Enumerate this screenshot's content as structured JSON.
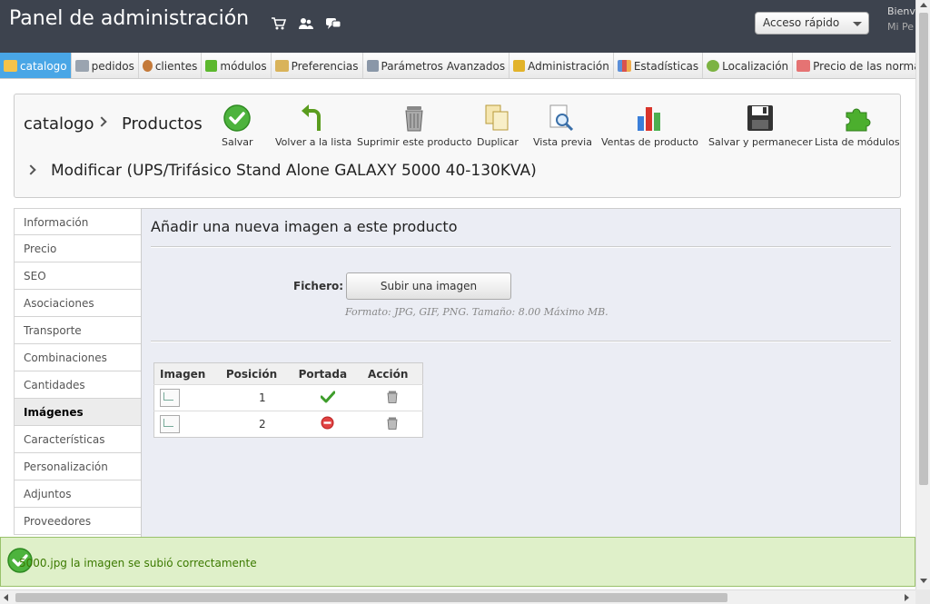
{
  "header": {
    "title": "Panel de administración",
    "icons": [
      "cart-icon",
      "users-icon",
      "chat-icon"
    ],
    "quick_access": "Acceso rápido",
    "welcome": "Bienv",
    "welcome_sub": "Mi Pe"
  },
  "menu": {
    "items": [
      {
        "label": "catalogo",
        "icon": "folder-icon",
        "color": "#f6c34a"
      },
      {
        "label": "pedidos",
        "icon": "cart-icon",
        "color": "#9aa4b0"
      },
      {
        "label": "clientes",
        "icon": "user-icon",
        "color": "#c47a3a"
      },
      {
        "label": "módulos",
        "icon": "puzzle-icon",
        "color": "#5cb82e"
      },
      {
        "label": "Preferencias",
        "icon": "pencil-icon",
        "color": "#d9b35a"
      },
      {
        "label": "Parámetros Avanzados",
        "icon": "wrench-icon",
        "color": "#8a97a8"
      },
      {
        "label": "Administración",
        "icon": "key-icon",
        "color": "#e2b32a"
      },
      {
        "label": "Estadísticas",
        "icon": "bar-chart-icon",
        "color": "#d9534f"
      },
      {
        "label": "Localización",
        "icon": "globe-icon",
        "color": "#7cb342"
      },
      {
        "label": "Precio de las norma",
        "icon": "price-icon",
        "color": "#e57373"
      }
    ]
  },
  "toolbar": {
    "crumb1": "catalogo",
    "crumb2": "Productos",
    "edit_title": "Modificar (UPS/Trifásico Stand Alone GALAXY 5000 40-130KVA)",
    "buttons": {
      "save": "Salvar",
      "back": "Volver a la lista",
      "delete": "Suprimir este producto",
      "duplicate": "Duplicar",
      "preview": "Vista previa",
      "sales": "Ventas de producto",
      "save_stay": "Salvar y permanecer",
      "modules": "Lista de módulos"
    }
  },
  "tabs": [
    "Información",
    "Precio",
    "SEO",
    "Asociaciones",
    "Transporte",
    "Combinaciones",
    "Cantidades",
    "Imágenes",
    "Características",
    "Personalización",
    "Adjuntos",
    "Proveedores"
  ],
  "active_tab": "Imágenes",
  "content": {
    "title": "Añadir una nueva imagen a este producto",
    "file_label": "Fichero:",
    "upload_button": "Subir una imagen",
    "format_hint": "Formato: JPG, GIF, PNG. Tamaño: 8.00 Máximo MB.",
    "table": {
      "headers": [
        "Imagen",
        "Posición",
        "Portada",
        "Acción"
      ],
      "rows": [
        {
          "position": "1",
          "cover": true
        },
        {
          "position": "2",
          "cover": false
        }
      ]
    }
  },
  "notification": {
    "message": "5000.jpg la imagen se subió correctamente"
  },
  "colors": {
    "header_bg": "#3d434e",
    "active_menu": "#49a6e6",
    "content_bg": "#ebedf4",
    "success_bg": "#dff0c9",
    "success_text": "#3c7a00"
  }
}
